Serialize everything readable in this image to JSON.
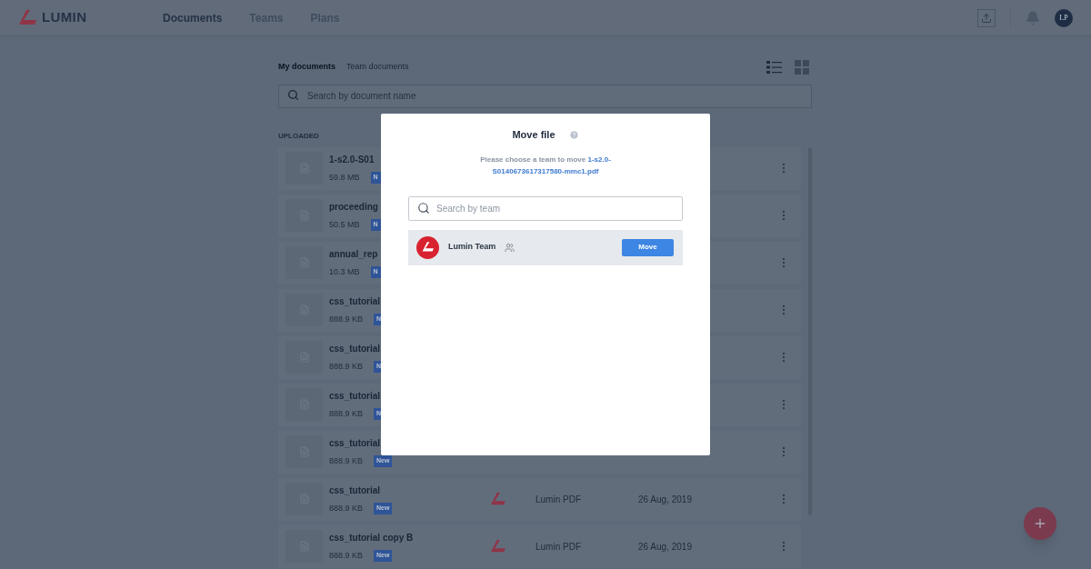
{
  "header": {
    "logo": "LUMIN",
    "nav": [
      {
        "label": "Documents",
        "selected": true
      },
      {
        "label": "Teams",
        "selected": false
      },
      {
        "label": "Plans",
        "selected": false
      }
    ],
    "avatar": "LP"
  },
  "documents": {
    "tabs": [
      {
        "label": "My documents",
        "selected": true
      },
      {
        "label": "Team documents",
        "selected": false
      }
    ],
    "view_modes": [
      {
        "kind": "list",
        "selected": true
      },
      {
        "kind": "grid",
        "selected": false
      }
    ],
    "search": {
      "placeholder": "Search by document name"
    },
    "section": "UPLOADED",
    "rows": [
      {
        "name": "1-s2.0-S01",
        "size": "59.8 MB",
        "badge": "N"
      },
      {
        "name": "proceeding",
        "size": "50.5 MB",
        "badge": "N"
      },
      {
        "name": "annual_rep",
        "size": "10.3 MB",
        "badge": "N"
      },
      {
        "name": "css_tutorial",
        "size": "888.9 KB",
        "badge": "N"
      },
      {
        "name": "css_tutorial",
        "size": "888.9 KB",
        "badge": "N"
      },
      {
        "name": "css_tutorial",
        "size": "888.9 KB",
        "badge": "N"
      },
      {
        "name": "css_tutorial",
        "size": "888.9 KB",
        "badge": "New"
      },
      {
        "name": "css_tutorial",
        "size": "888.9 KB",
        "badge": "New",
        "source": "Lumin PDF",
        "date": "26 Aug, 2019"
      },
      {
        "name": "css_tutorial copy B",
        "size": "888.9 KB",
        "badge": "New",
        "source": "Lumin PDF",
        "date": "26 Aug, 2019"
      }
    ]
  },
  "modal": {
    "title": "Move file",
    "message": "Please choose a team to move",
    "file_name": "1-s2.0-S0140673617317580-mmc1.pdf",
    "search": {
      "placeholder": "Search by team"
    },
    "teams": [
      {
        "name": "Lumin Team",
        "action": "Move"
      }
    ]
  }
}
